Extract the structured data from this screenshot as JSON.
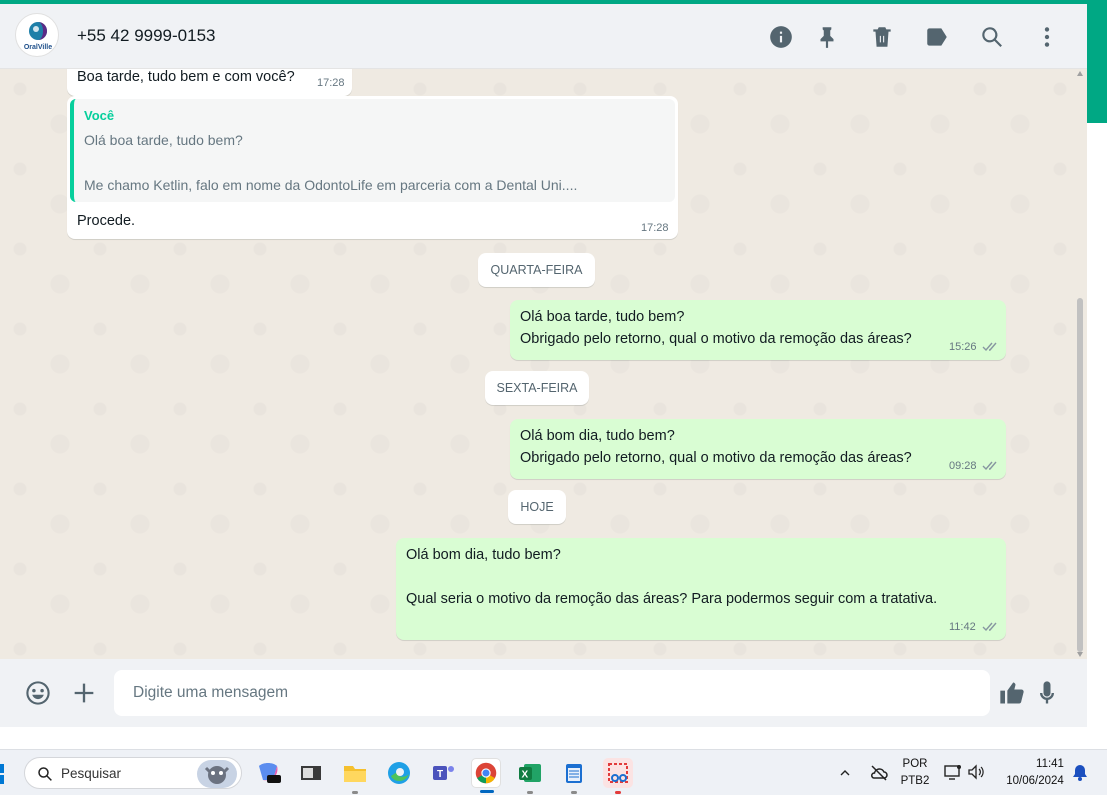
{
  "header": {
    "avatar_brand": "OralVille",
    "contact_name": "+55 42 9999-0153",
    "icons": [
      "info-icon",
      "pin-icon",
      "delete-icon",
      "label-icon",
      "search-icon",
      "menu-dots-icon"
    ]
  },
  "messages": {
    "m0": {
      "text": "Boa tarde, tudo bem e com você?",
      "time": "17:28"
    },
    "m1": {
      "quote_author": "Você",
      "quote_line1": "Olá boa tarde, tudo bem?",
      "quote_line2": "Me chamo Ketlin, falo em nome da OdontoLife em parceria com a Dental Uni....",
      "text": "Procede.",
      "time": "17:28"
    },
    "date1": "QUARTA-FEIRA",
    "m2": {
      "line1": "Olá boa tarde, tudo bem?",
      "line2": "Obrigado pelo retorno, qual o motivo da remoção das áreas?",
      "time": "15:26"
    },
    "date2": "SEXTA-FEIRA",
    "m3": {
      "line1": "Olá bom dia, tudo bem?",
      "line2": "Obrigado pelo retorno, qual o motivo da remoção das áreas?",
      "time": "09:28"
    },
    "date3": "HOJE",
    "m4": {
      "line1": "Olá bom dia, tudo bem?",
      "line2": "Qual seria o motivo da remoção das áreas? Para podermos seguir com a tratativa.",
      "time": "11:42"
    }
  },
  "composer": {
    "placeholder": "Digite uma mensagem"
  },
  "taskbar": {
    "search_label": "Pesquisar",
    "language": "POR",
    "keyboard": "PTB2",
    "time": "11:41",
    "date": "10/06/2024"
  },
  "colors": {
    "accent": "#00a884",
    "outgoing_bubble": "#d9fdd3",
    "incoming_bubble": "#ffffff",
    "chat_bg": "#efeae2",
    "tick_gray": "#8696a0"
  }
}
